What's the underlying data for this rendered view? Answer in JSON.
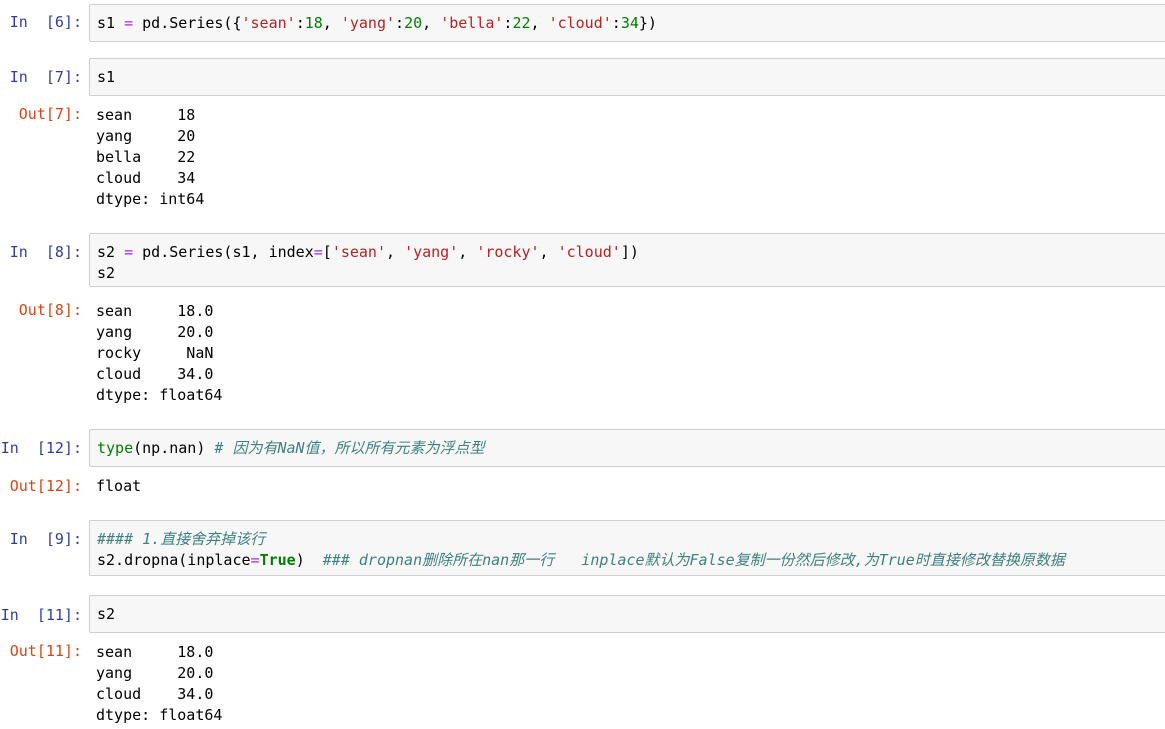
{
  "cells": [
    {
      "in_prompt": "In  [6]:",
      "input_lines": [
        [
          [
            "s1 ",
            "plain"
          ],
          [
            "=",
            "op"
          ],
          [
            " pd.Series({",
            "plain"
          ],
          [
            "'sean'",
            "str"
          ],
          [
            ":",
            "plain"
          ],
          [
            "18",
            "num"
          ],
          [
            ", ",
            "plain"
          ],
          [
            "'yang'",
            "str"
          ],
          [
            ":",
            "plain"
          ],
          [
            "20",
            "num"
          ],
          [
            ", ",
            "plain"
          ],
          [
            "'bella'",
            "str"
          ],
          [
            ":",
            "plain"
          ],
          [
            "22",
            "num"
          ],
          [
            ", ",
            "plain"
          ],
          [
            "'cloud'",
            "str"
          ],
          [
            ":",
            "plain"
          ],
          [
            "34",
            "num"
          ],
          [
            "})",
            "plain"
          ]
        ]
      ]
    },
    {
      "in_prompt": "In  [7]:",
      "input_lines": [
        [
          [
            "s1",
            "plain"
          ]
        ]
      ],
      "out_prompt": "Out[7]:",
      "output_lines": [
        "sean     18",
        "yang     20",
        "bella    22",
        "cloud    34",
        "dtype: int64"
      ]
    },
    {
      "in_prompt": "In  [8]:",
      "input_lines": [
        [
          [
            "s2 ",
            "plain"
          ],
          [
            "=",
            "op"
          ],
          [
            " pd.Series(s1, index",
            "plain"
          ],
          [
            "=",
            "op"
          ],
          [
            "[",
            "plain"
          ],
          [
            "'sean'",
            "str"
          ],
          [
            ", ",
            "plain"
          ],
          [
            "'yang'",
            "str"
          ],
          [
            ", ",
            "plain"
          ],
          [
            "'rocky'",
            "str"
          ],
          [
            ", ",
            "plain"
          ],
          [
            "'cloud'",
            "str"
          ],
          [
            "])",
            "plain"
          ]
        ],
        [
          [
            "s2",
            "plain"
          ]
        ]
      ],
      "out_prompt": "Out[8]:",
      "output_lines": [
        "sean     18.0",
        "yang     20.0",
        "rocky     NaN",
        "cloud    34.0",
        "dtype: float64"
      ]
    },
    {
      "in_prompt": "In  [12]:",
      "input_lines": [
        [
          [
            "type",
            "bi"
          ],
          [
            "(np.nan) ",
            "plain"
          ],
          [
            "# 因为有NaN值，所以所有元素为浮点型",
            "cm"
          ]
        ]
      ],
      "out_prompt": "Out[12]:",
      "output_lines": [
        "float"
      ]
    },
    {
      "in_prompt": "In  [9]:",
      "input_lines": [
        [
          [
            "#### 1.直接舍弃掉该行",
            "cm"
          ]
        ],
        [
          [
            "s2.dropna(inplace",
            "plain"
          ],
          [
            "=",
            "op"
          ],
          [
            "True",
            "kw"
          ],
          [
            ")  ",
            "plain"
          ],
          [
            "### dropnan删除所在nan那一行   inplace默认为False复制一份然后修改,为True时直接修改替换原数据",
            "cm"
          ]
        ]
      ]
    },
    {
      "in_prompt": "In  [11]:",
      "input_lines": [
        [
          [
            "s2",
            "plain"
          ]
        ]
      ],
      "out_prompt": "Out[11]:",
      "output_lines": [
        "sean     18.0",
        "yang     20.0",
        "cloud    34.0",
        "dtype: float64"
      ]
    }
  ]
}
